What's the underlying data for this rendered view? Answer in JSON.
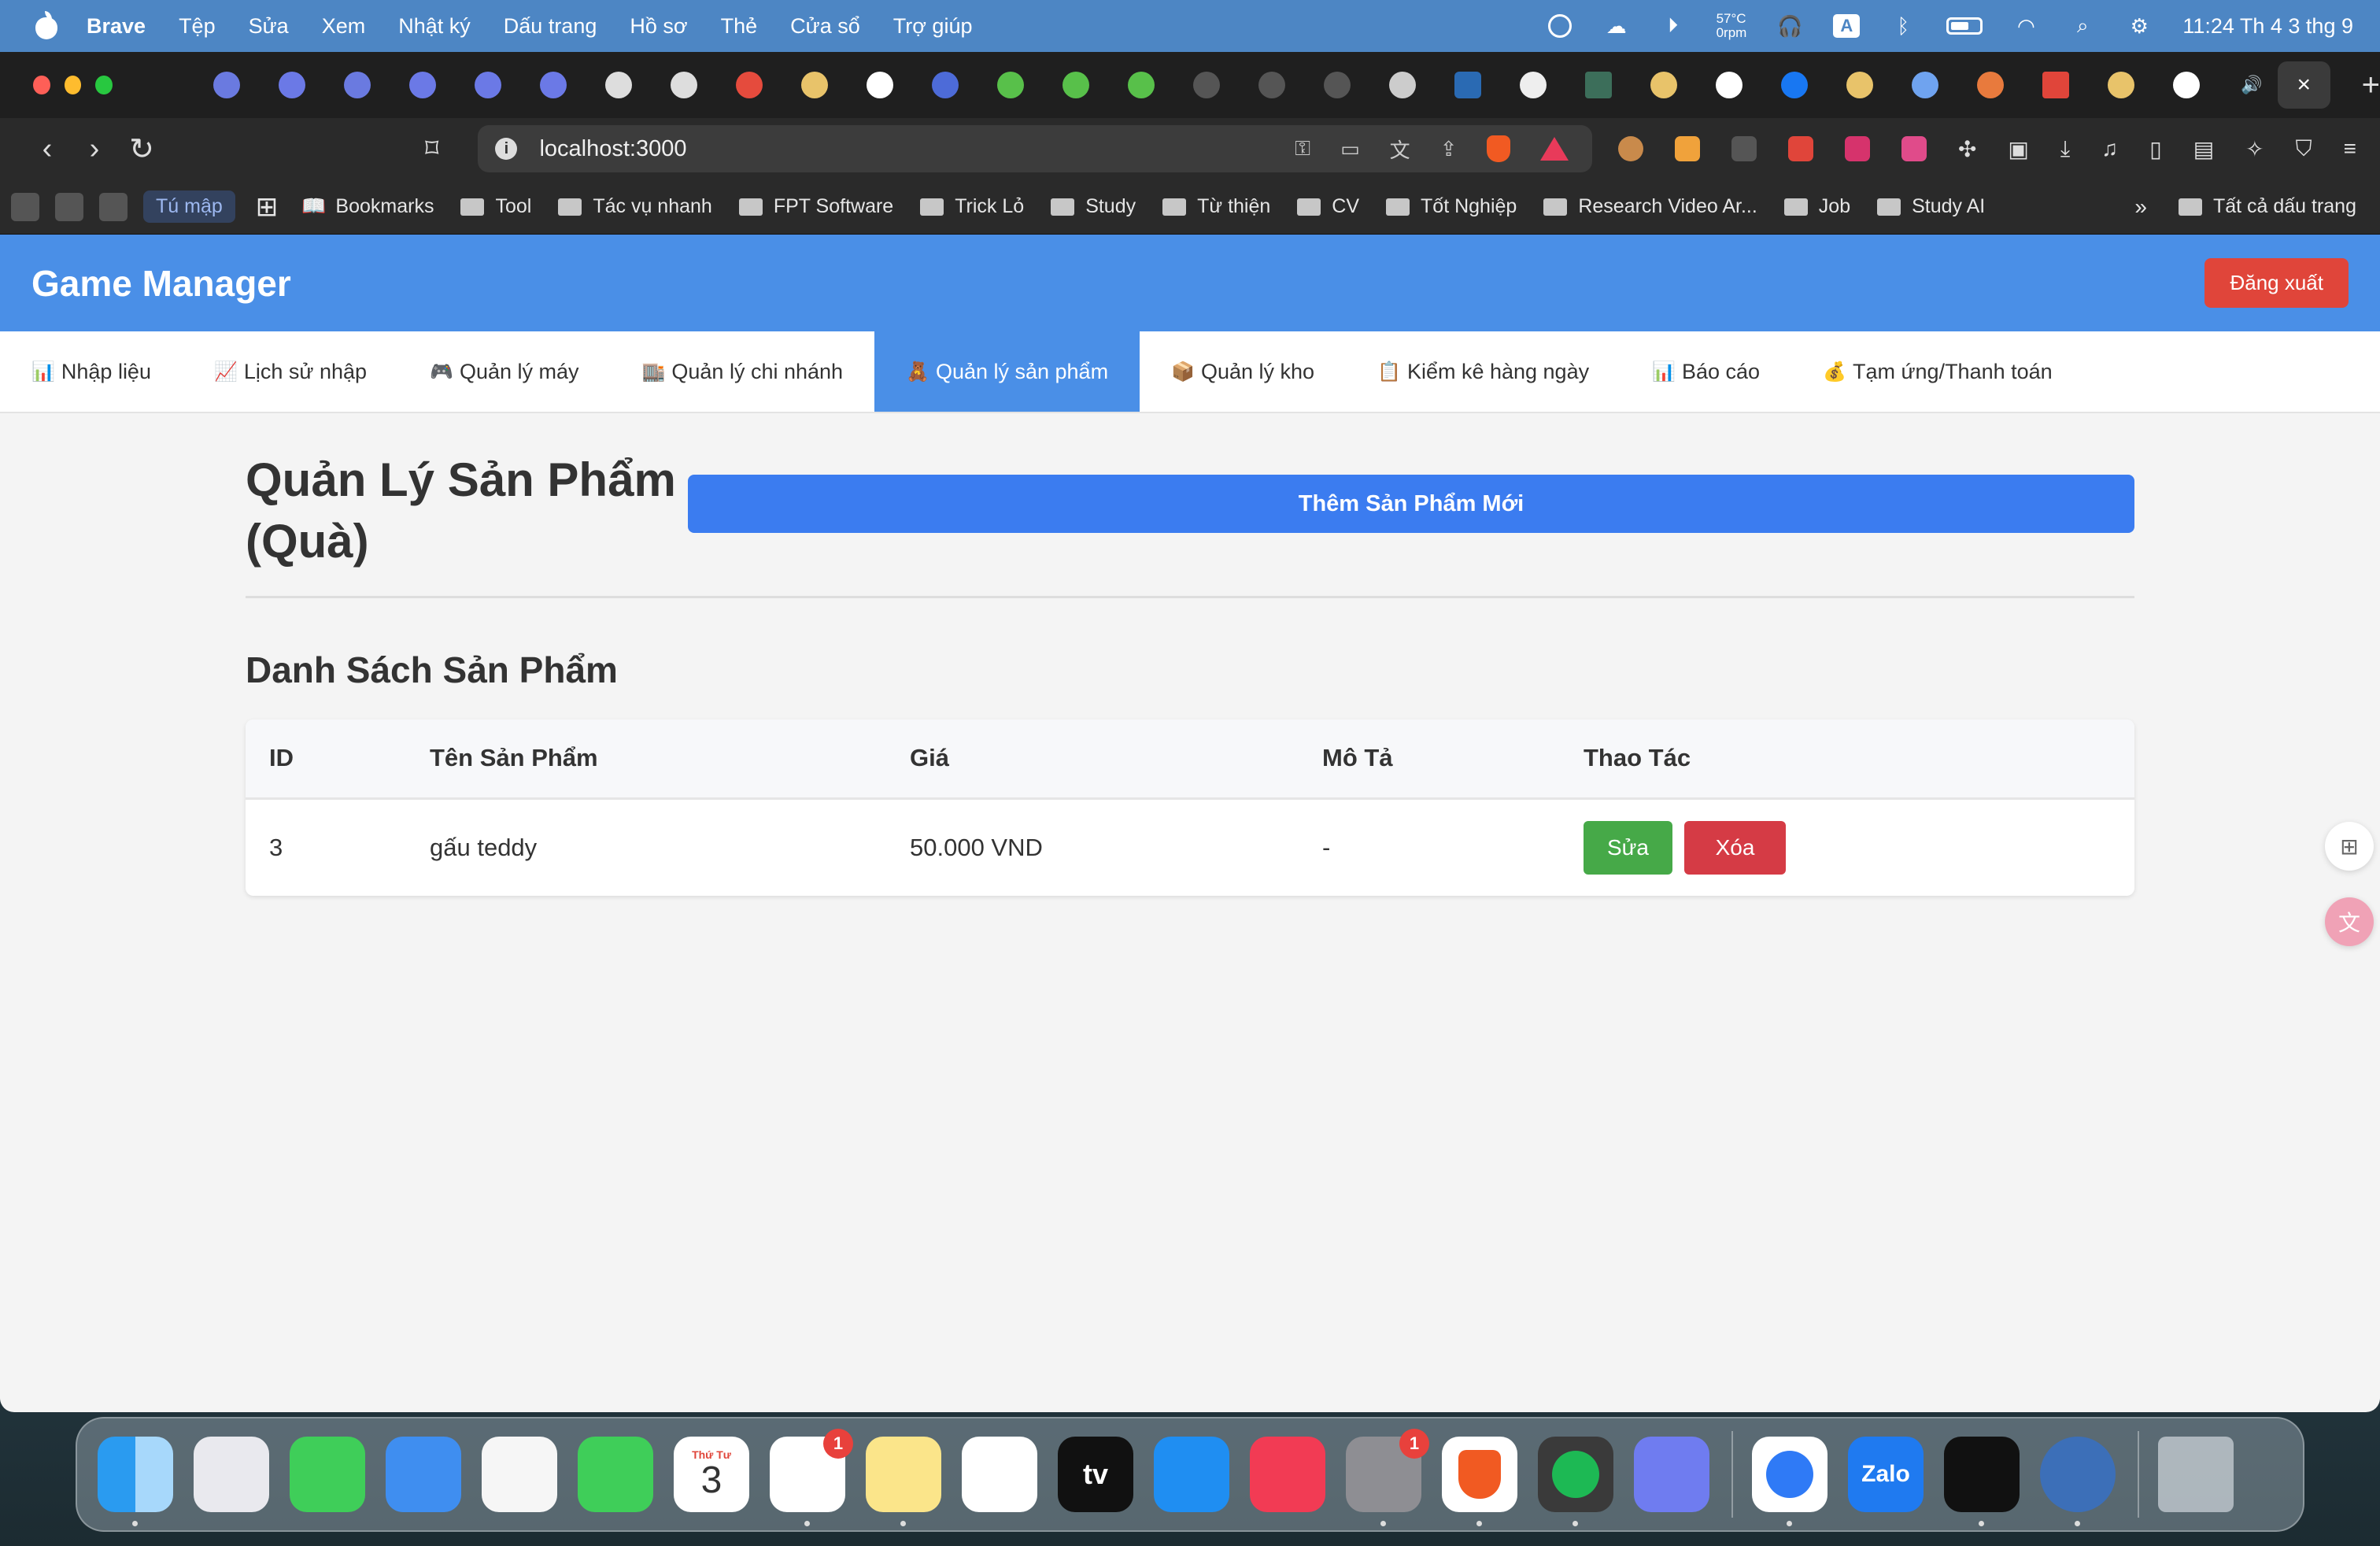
{
  "menubar": {
    "app": "Brave",
    "items": [
      "Tệp",
      "Sửa",
      "Xem",
      "Nhật ký",
      "Dấu trang",
      "Hồ sơ",
      "Thẻ",
      "Cửa sổ",
      "Trợ giúp"
    ],
    "temp": "57°C",
    "rpm": "0rpm",
    "input_source": "A",
    "clock": "11:24 Th 4 3 thg 9"
  },
  "browser": {
    "url": "localhost:3000",
    "tab_close": "×",
    "new_tab": "+",
    "bookmarks": {
      "tumap": "Tú mập",
      "items": [
        "Bookmarks",
        "Tool",
        "Tác vụ nhanh",
        "FPT Software",
        "Trick Lỏ",
        "Study",
        "Từ thiện",
        "CV",
        "Tốt Nghiệp",
        "Research Video Ar...",
        "Job",
        "Study AI"
      ],
      "more": "»",
      "all": "Tất cả dấu trang"
    }
  },
  "app": {
    "title": "Game Manager",
    "logout": "Đăng xuất",
    "nav": [
      {
        "emoji": "📊",
        "label": "Nhập liệu"
      },
      {
        "emoji": "📈",
        "label": "Lịch sử nhập"
      },
      {
        "emoji": "🎮",
        "label": "Quản lý máy"
      },
      {
        "emoji": "🏬",
        "label": "Quản lý chi nhánh"
      },
      {
        "emoji": "🧸",
        "label": "Quản lý sản phẩm"
      },
      {
        "emoji": "📦",
        "label": "Quản lý kho"
      },
      {
        "emoji": "📋",
        "label": "Kiểm kê hàng ngày"
      },
      {
        "emoji": "📊",
        "label": "Báo cáo"
      },
      {
        "emoji": "💰",
        "label": "Tạm ứng/Thanh toán"
      }
    ],
    "page_title": "Quản Lý Sản Phẩm (Quà)",
    "add_button": "Thêm Sản Phẩm Mới",
    "list_title": "Danh Sách Sản Phẩm",
    "table": {
      "headers": [
        "ID",
        "Tên Sản Phẩm",
        "Giá",
        "Mô Tả",
        "Thao Tác"
      ],
      "rows": [
        {
          "id": "3",
          "name": "gấu teddy",
          "price": "50.000 VND",
          "desc": "-",
          "edit": "Sửa",
          "delete": "Xóa"
        }
      ]
    }
  },
  "dock": {
    "calendar_weekday": "Thứ Tư",
    "calendar_day": "3",
    "badges": {
      "reminders": "1",
      "settings": "1"
    },
    "tv": "tv",
    "zalo": "Zalo"
  },
  "colors": {
    "menubar": "#4d86c4",
    "header": "#4a8fe7",
    "primary_button": "#3b7cf0",
    "logout": "#e0453a",
    "edit": "#46a948",
    "delete": "#d53b45"
  }
}
